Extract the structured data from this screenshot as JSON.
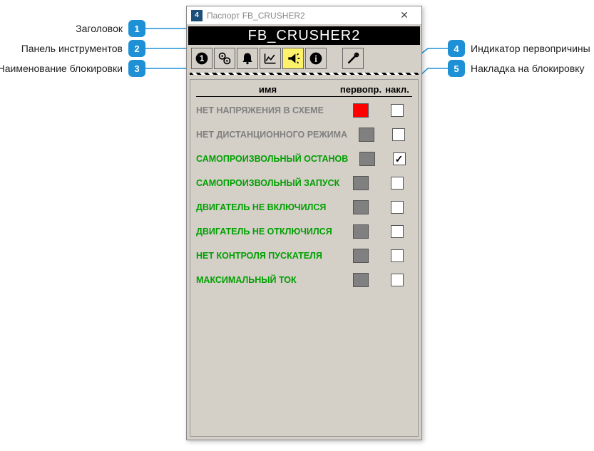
{
  "window": {
    "title": "Паспорт FB_CRUSHER2",
    "header": "FB_CRUSHER2"
  },
  "columns": {
    "name": "имя",
    "prime": "первопр.",
    "overlay": "накл."
  },
  "rows": [
    {
      "label": "НЕТ НАПРЯЖЕНИЯ В СХЕМЕ",
      "tone": "gray",
      "prime": "red",
      "overlay": false
    },
    {
      "label": "НЕТ ДИСТАНЦИОННОГО РЕЖИМА",
      "tone": "gray",
      "prime": "gray",
      "overlay": false
    },
    {
      "label": "САМОПРОИЗВОЛЬНЫЙ ОСТАНОВ",
      "tone": "green",
      "prime": "gray",
      "overlay": true
    },
    {
      "label": "САМОПРОИЗВОЛЬНЫЙ ЗАПУСК",
      "tone": "green",
      "prime": "gray",
      "overlay": false
    },
    {
      "label": "ДВИГАТЕЛЬ НЕ ВКЛЮЧИЛСЯ",
      "tone": "green",
      "prime": "gray",
      "overlay": false
    },
    {
      "label": "ДВИГАТЕЛЬ НЕ ОТКЛЮЧИЛСЯ",
      "tone": "green",
      "prime": "gray",
      "overlay": false
    },
    {
      "label": "НЕТ КОНТРОЛЯ ПУСКАТЕЛЯ",
      "tone": "green",
      "prime": "gray",
      "overlay": false
    },
    {
      "label": "МАКСИМАЛЬНЫЙ ТОК",
      "tone": "green",
      "prime": "gray",
      "overlay": false
    }
  ],
  "callouts": {
    "1": "Заголовок",
    "2": "Панель инструментов",
    "3": "Наименование блокировки",
    "4": "Индикатор первопричины",
    "5": "Накладка на блокировку"
  },
  "toolbar_buttons": [
    "one",
    "gears",
    "bell",
    "chart",
    "horn",
    "info",
    "tools"
  ]
}
